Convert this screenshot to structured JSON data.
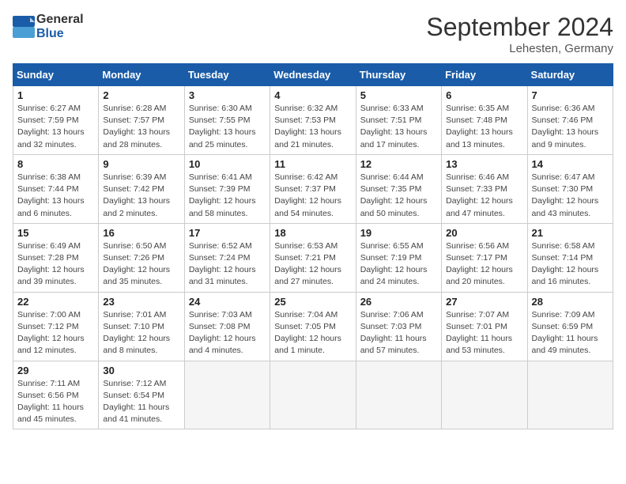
{
  "header": {
    "logo_general": "General",
    "logo_blue": "Blue",
    "month_title": "September 2024",
    "location": "Lehesten, Germany"
  },
  "days_of_week": [
    "Sunday",
    "Monday",
    "Tuesday",
    "Wednesday",
    "Thursday",
    "Friday",
    "Saturday"
  ],
  "weeks": [
    [
      {
        "day": "1",
        "lines": [
          "Sunrise: 6:27 AM",
          "Sunset: 7:59 PM",
          "Daylight: 13 hours",
          "and 32 minutes."
        ]
      },
      {
        "day": "2",
        "lines": [
          "Sunrise: 6:28 AM",
          "Sunset: 7:57 PM",
          "Daylight: 13 hours",
          "and 28 minutes."
        ]
      },
      {
        "day": "3",
        "lines": [
          "Sunrise: 6:30 AM",
          "Sunset: 7:55 PM",
          "Daylight: 13 hours",
          "and 25 minutes."
        ]
      },
      {
        "day": "4",
        "lines": [
          "Sunrise: 6:32 AM",
          "Sunset: 7:53 PM",
          "Daylight: 13 hours",
          "and 21 minutes."
        ]
      },
      {
        "day": "5",
        "lines": [
          "Sunrise: 6:33 AM",
          "Sunset: 7:51 PM",
          "Daylight: 13 hours",
          "and 17 minutes."
        ]
      },
      {
        "day": "6",
        "lines": [
          "Sunrise: 6:35 AM",
          "Sunset: 7:48 PM",
          "Daylight: 13 hours",
          "and 13 minutes."
        ]
      },
      {
        "day": "7",
        "lines": [
          "Sunrise: 6:36 AM",
          "Sunset: 7:46 PM",
          "Daylight: 13 hours",
          "and 9 minutes."
        ]
      }
    ],
    [
      {
        "day": "8",
        "lines": [
          "Sunrise: 6:38 AM",
          "Sunset: 7:44 PM",
          "Daylight: 13 hours",
          "and 6 minutes."
        ]
      },
      {
        "day": "9",
        "lines": [
          "Sunrise: 6:39 AM",
          "Sunset: 7:42 PM",
          "Daylight: 13 hours",
          "and 2 minutes."
        ]
      },
      {
        "day": "10",
        "lines": [
          "Sunrise: 6:41 AM",
          "Sunset: 7:39 PM",
          "Daylight: 12 hours",
          "and 58 minutes."
        ]
      },
      {
        "day": "11",
        "lines": [
          "Sunrise: 6:42 AM",
          "Sunset: 7:37 PM",
          "Daylight: 12 hours",
          "and 54 minutes."
        ]
      },
      {
        "day": "12",
        "lines": [
          "Sunrise: 6:44 AM",
          "Sunset: 7:35 PM",
          "Daylight: 12 hours",
          "and 50 minutes."
        ]
      },
      {
        "day": "13",
        "lines": [
          "Sunrise: 6:46 AM",
          "Sunset: 7:33 PM",
          "Daylight: 12 hours",
          "and 47 minutes."
        ]
      },
      {
        "day": "14",
        "lines": [
          "Sunrise: 6:47 AM",
          "Sunset: 7:30 PM",
          "Daylight: 12 hours",
          "and 43 minutes."
        ]
      }
    ],
    [
      {
        "day": "15",
        "lines": [
          "Sunrise: 6:49 AM",
          "Sunset: 7:28 PM",
          "Daylight: 12 hours",
          "and 39 minutes."
        ]
      },
      {
        "day": "16",
        "lines": [
          "Sunrise: 6:50 AM",
          "Sunset: 7:26 PM",
          "Daylight: 12 hours",
          "and 35 minutes."
        ]
      },
      {
        "day": "17",
        "lines": [
          "Sunrise: 6:52 AM",
          "Sunset: 7:24 PM",
          "Daylight: 12 hours",
          "and 31 minutes."
        ]
      },
      {
        "day": "18",
        "lines": [
          "Sunrise: 6:53 AM",
          "Sunset: 7:21 PM",
          "Daylight: 12 hours",
          "and 27 minutes."
        ]
      },
      {
        "day": "19",
        "lines": [
          "Sunrise: 6:55 AM",
          "Sunset: 7:19 PM",
          "Daylight: 12 hours",
          "and 24 minutes."
        ]
      },
      {
        "day": "20",
        "lines": [
          "Sunrise: 6:56 AM",
          "Sunset: 7:17 PM",
          "Daylight: 12 hours",
          "and 20 minutes."
        ]
      },
      {
        "day": "21",
        "lines": [
          "Sunrise: 6:58 AM",
          "Sunset: 7:14 PM",
          "Daylight: 12 hours",
          "and 16 minutes."
        ]
      }
    ],
    [
      {
        "day": "22",
        "lines": [
          "Sunrise: 7:00 AM",
          "Sunset: 7:12 PM",
          "Daylight: 12 hours",
          "and 12 minutes."
        ]
      },
      {
        "day": "23",
        "lines": [
          "Sunrise: 7:01 AM",
          "Sunset: 7:10 PM",
          "Daylight: 12 hours",
          "and 8 minutes."
        ]
      },
      {
        "day": "24",
        "lines": [
          "Sunrise: 7:03 AM",
          "Sunset: 7:08 PM",
          "Daylight: 12 hours",
          "and 4 minutes."
        ]
      },
      {
        "day": "25",
        "lines": [
          "Sunrise: 7:04 AM",
          "Sunset: 7:05 PM",
          "Daylight: 12 hours",
          "and 1 minute."
        ]
      },
      {
        "day": "26",
        "lines": [
          "Sunrise: 7:06 AM",
          "Sunset: 7:03 PM",
          "Daylight: 11 hours",
          "and 57 minutes."
        ]
      },
      {
        "day": "27",
        "lines": [
          "Sunrise: 7:07 AM",
          "Sunset: 7:01 PM",
          "Daylight: 11 hours",
          "and 53 minutes."
        ]
      },
      {
        "day": "28",
        "lines": [
          "Sunrise: 7:09 AM",
          "Sunset: 6:59 PM",
          "Daylight: 11 hours",
          "and 49 minutes."
        ]
      }
    ],
    [
      {
        "day": "29",
        "lines": [
          "Sunrise: 7:11 AM",
          "Sunset: 6:56 PM",
          "Daylight: 11 hours",
          "and 45 minutes."
        ]
      },
      {
        "day": "30",
        "lines": [
          "Sunrise: 7:12 AM",
          "Sunset: 6:54 PM",
          "Daylight: 11 hours",
          "and 41 minutes."
        ]
      },
      {
        "day": "",
        "lines": []
      },
      {
        "day": "",
        "lines": []
      },
      {
        "day": "",
        "lines": []
      },
      {
        "day": "",
        "lines": []
      },
      {
        "day": "",
        "lines": []
      }
    ]
  ]
}
